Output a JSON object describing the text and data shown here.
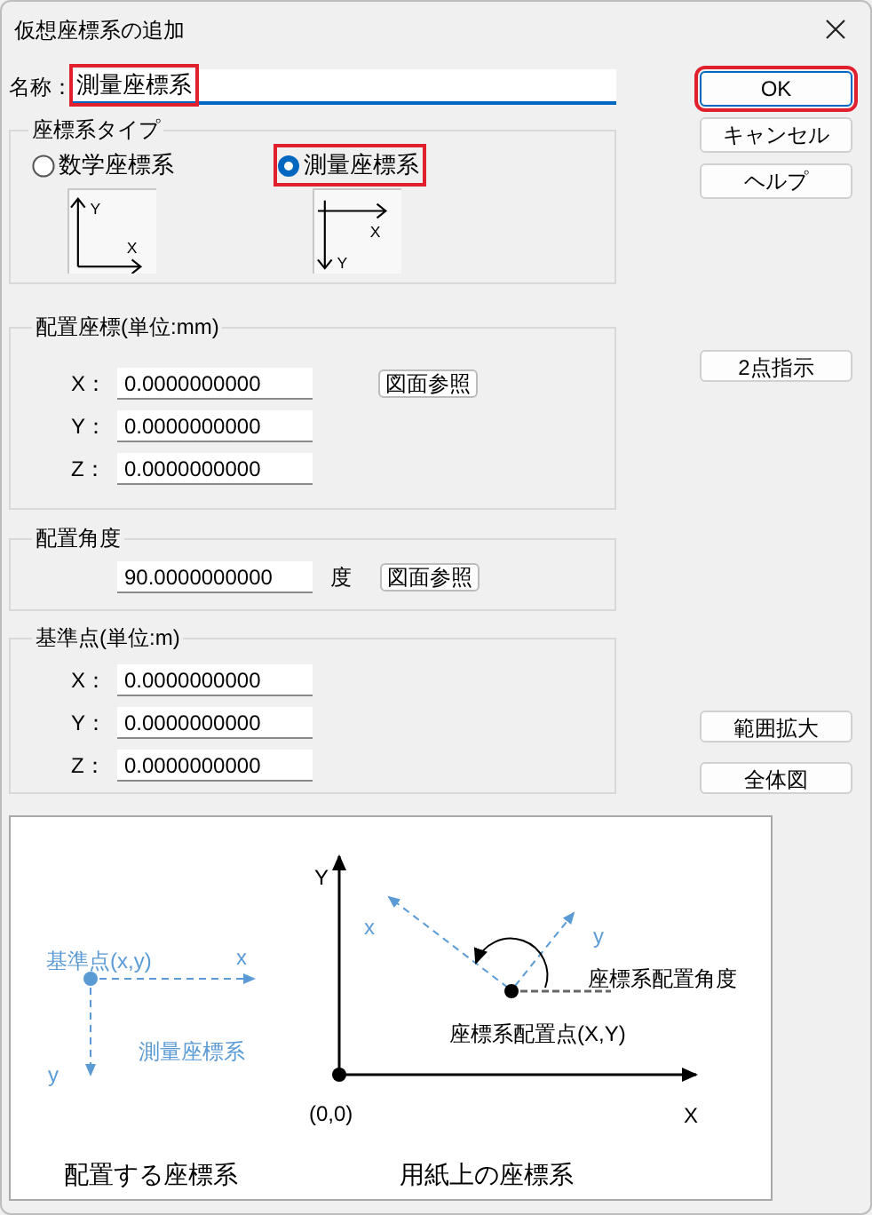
{
  "window": {
    "title": "仮想座標系の追加"
  },
  "name_field": {
    "label": "名称：",
    "value": "測量座標系",
    "highlighted": true
  },
  "coordinate_type": {
    "legend": "座標系タイプ",
    "options": [
      {
        "label": "数学座標系",
        "kind": "math",
        "selected": false,
        "highlighted": false,
        "axis_x": "X",
        "axis_y": "Y"
      },
      {
        "label": "測量座標系",
        "kind": "survey",
        "selected": true,
        "highlighted": true,
        "axis_x": "X",
        "axis_y": "Y"
      }
    ]
  },
  "placement": {
    "legend": "配置座標(単位:mm)",
    "reference_button": "図面参照",
    "rows": [
      {
        "label": "X：",
        "value": "0.0000000000"
      },
      {
        "label": "Y：",
        "value": "0.0000000000"
      },
      {
        "label": "Z：",
        "value": "0.0000000000"
      }
    ]
  },
  "angle": {
    "legend": "配置角度",
    "value": "90.0000000000",
    "unit": "度",
    "reference_button": "図面参照"
  },
  "base_point": {
    "legend": "基準点(単位:m)",
    "rows": [
      {
        "label": "X：",
        "value": "0.0000000000"
      },
      {
        "label": "Y：",
        "value": "0.0000000000"
      },
      {
        "label": "Z：",
        "value": "0.0000000000"
      }
    ]
  },
  "buttons_top": [
    {
      "label": "OK",
      "highlighted": true
    },
    {
      "label": "キャンセル",
      "highlighted": false
    },
    {
      "label": "ヘルプ",
      "highlighted": false
    }
  ],
  "button_two_points": {
    "label": "2点指示"
  },
  "buttons_bottom": [
    {
      "label": "範囲拡大"
    },
    {
      "label": "全体図"
    }
  ],
  "diagram": {
    "base_point_label": "基準点(x,y)",
    "local_x": "x",
    "local_y": "y",
    "local_name": "測量座標系",
    "left_caption": "配置する座標系",
    "axis_y": "Y",
    "axis_x": "X",
    "origin": "(0,0)",
    "rotated_x": "x",
    "rotated_y": "y",
    "angle_label": "座標系配置角度",
    "point_label": "座標系配置点(X,Y)",
    "right_caption": "用紙上の座標系"
  }
}
